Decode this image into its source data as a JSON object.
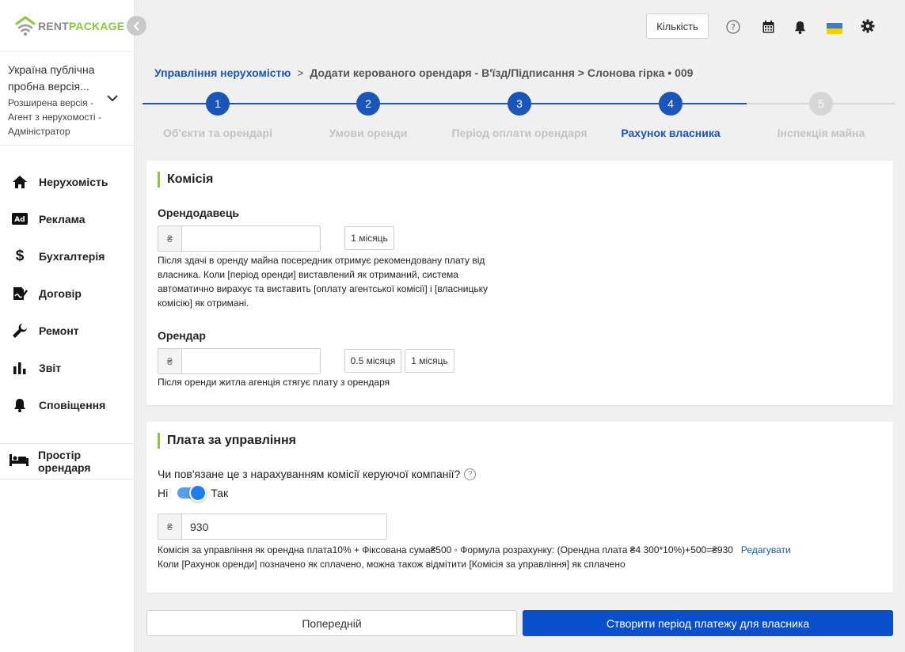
{
  "brand": {
    "rent": "RENT",
    "package": "PACKAGE"
  },
  "account": {
    "org": "Україна публічна пробна версія...",
    "role": "Розширена версія - Агент з нерухомості - Адміністратор"
  },
  "nav": {
    "items": [
      {
        "label": "Нерухомість",
        "icon": "home-icon"
      },
      {
        "label": "Реклама",
        "icon": "ad-icon"
      },
      {
        "label": "Бухгалтерія",
        "icon": "dollar-icon"
      },
      {
        "label": "Договір",
        "icon": "contract-icon"
      },
      {
        "label": "Ремонт",
        "icon": "wrench-icon"
      },
      {
        "label": "Звіт",
        "icon": "bar-chart-icon"
      },
      {
        "label": "Сповіщення",
        "icon": "bell-icon"
      }
    ],
    "tenant_space": "Простір орендаря"
  },
  "header": {
    "quantity_label": "Кількість"
  },
  "breadcrumb": {
    "root": "Управління нерухомістю",
    "sep": ">",
    "path": "Додати керованого орендаря - В'їзд/Підписання > Слонова гірка • 009"
  },
  "steps": [
    {
      "num": "1",
      "label": "Об'єкти та орендарі",
      "state": "done"
    },
    {
      "num": "2",
      "label": "Умови оренди",
      "state": "done"
    },
    {
      "num": "3",
      "label": "Період оплати орендаря",
      "state": "done"
    },
    {
      "num": "4",
      "label": "Рахунок власника",
      "state": "active"
    },
    {
      "num": "5",
      "label": "Інспекція майна",
      "state": "todo"
    }
  ],
  "commission": {
    "title": "Комісія",
    "landlord_label": "Орендодавець",
    "landlord_currency": "₴",
    "landlord_value": "",
    "landlord_chip": "1 місяць",
    "landlord_help": "Після здачі в оренду майна посередник отримує рекомендовану плату від власника. Коли [період оренди] виставлений як отриманий, система автоматично вирахує та виставить [оплату агентської комісії] і [власницьку комісію] як отримані.",
    "tenant_label": "Орендар",
    "tenant_currency": "₴",
    "tenant_value": "",
    "tenant_chip_1": "0.5 місяця",
    "tenant_chip_2": "1 місяць",
    "tenant_help": "Після оренди житла агенція стягує плату з орендаря"
  },
  "management": {
    "title": "Плата за управління",
    "question": "Чи пов'язане це з нарахуванням комісії керуючої компанії?",
    "no": "Ні",
    "yes": "Так",
    "currency": "₴",
    "value": "930",
    "formula": "Комісія за управління як орендна плата10% + Фіксована сума₴500 ◦ Формула розрахунку: (Орендна плата ₴4 300*10%)+500=₴930",
    "edit": "Редагувати",
    "note": "Коли [Рахунок оренди] позначено як сплачено, можна також відмітити [Комісія за управління] як сплачено"
  },
  "actions": {
    "previous": "Попередній",
    "create": "Створити період платежу для власника"
  },
  "colors": {
    "primary": "#0a4fce",
    "accent": "#8dc63f",
    "step_active": "#1a55b8",
    "step_todo": "#d6d6d6"
  }
}
